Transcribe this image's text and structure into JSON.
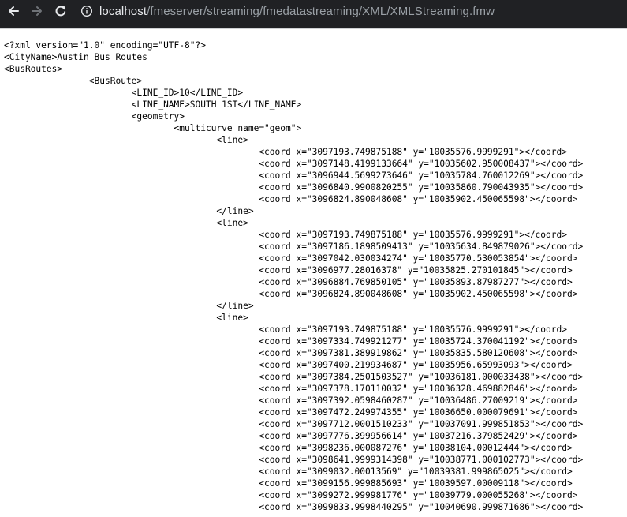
{
  "browser": {
    "url_host": "localhost",
    "url_path": "/fmeserver/streaming/fmedatastreaming/XML/XMLStreaming.fmw"
  },
  "icons": {
    "back": "back-arrow-icon",
    "forward": "forward-arrow-icon",
    "reload": "reload-icon",
    "info": "info-icon"
  },
  "colors": {
    "toolbar": "#202124",
    "url_host": "#e8eaed",
    "url_path": "#9aa0a6"
  },
  "document": {
    "lines": [
      "<?xml version=\"1.0\" encoding=\"UTF-8\"?>",
      "<CityName>Austin Bus Routes",
      "<BusRoutes>",
      "\t\t<BusRoute>",
      "\t\t\t<LINE_ID>10</LINE_ID>",
      "\t\t\t<LINE_NAME>SOUTH 1ST</LINE_NAME>",
      "\t\t\t<geometry>",
      "\t\t\t\t<multicurve name=\"geom\">",
      "\t\t\t\t\t<line>",
      "\t\t\t\t\t\t<coord x=\"3097193.749875188\" y=\"10035576.9999291\"></coord>",
      "\t\t\t\t\t\t<coord x=\"3097148.4199133664\" y=\"10035602.950008437\"></coord>",
      "\t\t\t\t\t\t<coord x=\"3096944.5699273646\" y=\"10035784.760012269\"></coord>",
      "\t\t\t\t\t\t<coord x=\"3096840.9900820255\" y=\"10035860.790043935\"></coord>",
      "\t\t\t\t\t\t<coord x=\"3096824.890048608\" y=\"10035902.450065598\"></coord>",
      "\t\t\t\t\t</line>",
      "\t\t\t\t\t<line>",
      "\t\t\t\t\t\t<coord x=\"3097193.749875188\" y=\"10035576.9999291\"></coord>",
      "\t\t\t\t\t\t<coord x=\"3097186.1898509413\" y=\"10035634.849879026\"></coord>",
      "\t\t\t\t\t\t<coord x=\"3097042.030034274\" y=\"10035770.530053854\"></coord>",
      "\t\t\t\t\t\t<coord x=\"3096977.28016378\" y=\"10035825.270101845\"></coord>",
      "\t\t\t\t\t\t<coord x=\"3096884.769850105\" y=\"10035893.87987277\"></coord>",
      "\t\t\t\t\t\t<coord x=\"3096824.890048608\" y=\"10035902.450065598\"></coord>",
      "\t\t\t\t\t</line>",
      "\t\t\t\t\t<line>",
      "\t\t\t\t\t\t<coord x=\"3097193.749875188\" y=\"10035576.9999291\"></coord>",
      "\t\t\t\t\t\t<coord x=\"3097334.749921277\" y=\"10035724.370041192\"></coord>",
      "\t\t\t\t\t\t<coord x=\"3097381.389919862\" y=\"10035835.580120608\"></coord>",
      "\t\t\t\t\t\t<coord x=\"3097400.219934687\" y=\"10035956.65993093\"></coord>",
      "\t\t\t\t\t\t<coord x=\"3097384.2501503527\" y=\"10036181.000033438\"></coord>",
      "\t\t\t\t\t\t<coord x=\"3097378.170110032\" y=\"10036328.469882846\"></coord>",
      "\t\t\t\t\t\t<coord x=\"3097392.0598460287\" y=\"10036486.27009219\"></coord>",
      "\t\t\t\t\t\t<coord x=\"3097472.249974355\" y=\"10036650.000079691\"></coord>",
      "\t\t\t\t\t\t<coord x=\"3097712.0001510233\" y=\"10037091.999851853\"></coord>",
      "\t\t\t\t\t\t<coord x=\"3097776.399956614\" y=\"10037216.379852429\"></coord>",
      "\t\t\t\t\t\t<coord x=\"3098236.000087276\" y=\"10038104.00012444\"></coord>",
      "\t\t\t\t\t\t<coord x=\"3098641.9999314398\" y=\"10038771.000102773\"></coord>",
      "\t\t\t\t\t\t<coord x=\"3099032.00013569\" y=\"10039381.999865025\"></coord>",
      "\t\t\t\t\t\t<coord x=\"3099156.999885693\" y=\"10039597.00009118\"></coord>",
      "\t\t\t\t\t\t<coord x=\"3099272.999981776\" y=\"10039779.000055268\"></coord>",
      "\t\t\t\t\t\t<coord x=\"3099833.9998440295\" y=\"10040690.999871686\"></coord>"
    ]
  }
}
